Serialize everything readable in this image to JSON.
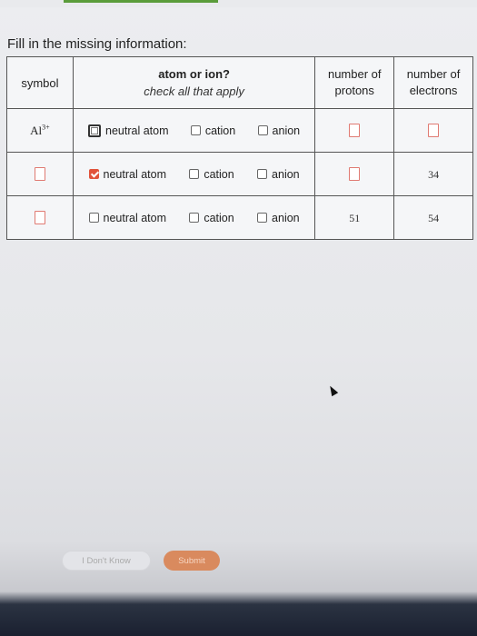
{
  "prompt": "Fill in the missing information:",
  "headers": {
    "symbol": "symbol",
    "atom_or_ion": "atom or ion?",
    "check_all": "check all that apply",
    "protons_1": "number of",
    "protons_2": "protons",
    "electrons_1": "number of",
    "electrons_2": "electrons"
  },
  "options": {
    "neutral": "neutral atom",
    "cation": "cation",
    "anion": "anion"
  },
  "rows": [
    {
      "symbol": "Al",
      "charge": "3+",
      "protons": "",
      "electrons": "",
      "neutral_checked": false,
      "cation_checked": false,
      "anion_checked": false
    },
    {
      "symbol": "",
      "charge": "",
      "protons": "",
      "electrons": "34",
      "neutral_checked": true,
      "cation_checked": false,
      "anion_checked": false
    },
    {
      "symbol": "",
      "charge": "",
      "protons": "51",
      "electrons": "54",
      "neutral_checked": false,
      "cation_checked": false,
      "anion_checked": false
    }
  ],
  "buttons": {
    "dont_know": "I Don't Know",
    "submit": "Submit"
  },
  "colors": {
    "accent_check": "#e1533b",
    "input_border": "#e07a72",
    "submit_bg": "#d98a5e"
  }
}
